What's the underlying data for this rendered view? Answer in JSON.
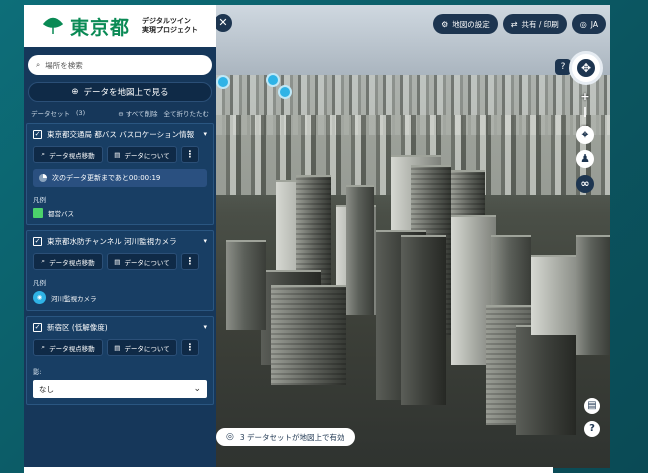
{
  "logo": {
    "main": "東京都",
    "sub_line1": "デジタルツイン",
    "sub_line2": "実現プロジェクト"
  },
  "search": {
    "placeholder": "場所を検索"
  },
  "add_data_button": "データを地図上で見る",
  "datasets_header": {
    "label": "データセット",
    "count": "(3)",
    "remove_all": "すべて削除",
    "collapse_all": "全て折りたたむ"
  },
  "datasets": [
    {
      "title": "東京都交通局 都バス バスロケーション情報",
      "checked": true,
      "view_button": "データ視点移動",
      "about_button": "データについて",
      "update_text": "次のデータ更新まであと00:00:19",
      "legend_label": "凡例",
      "legend_item": "都営バス",
      "legend_color": "#4cd26b"
    },
    {
      "title": "東京都水防チャンネル 河川監視カメラ",
      "checked": true,
      "view_button": "データ視点移動",
      "about_button": "データについて",
      "legend_label": "凡例",
      "legend_item": "河川監視カメラ",
      "legend_color": "#2fb3e6"
    },
    {
      "title": "新宿区 (低解像度)",
      "checked": true,
      "view_button": "データ視点移動",
      "about_button": "データについて",
      "shadow_label": "影:",
      "shadow_value": "なし"
    }
  ],
  "topbar": {
    "map_settings": "地図の設定",
    "share_print": "共有 / 印刷",
    "language": "JA"
  },
  "help_label": "?",
  "bottom_chip": "3 データセットが地図上で有効"
}
